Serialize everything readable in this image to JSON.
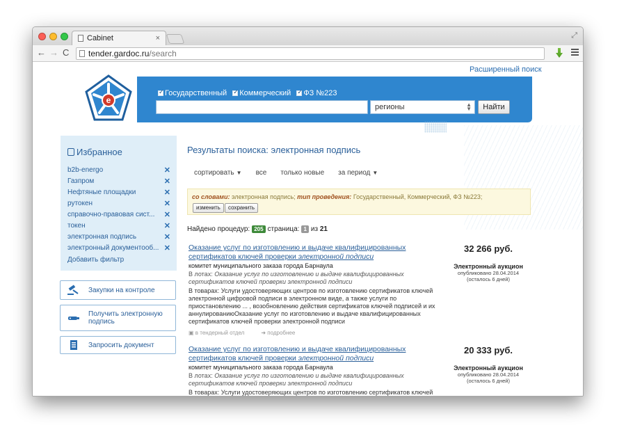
{
  "browser": {
    "tab_title": "Cabinet",
    "tab_close": "×",
    "url_host": "tender.gardoc.ru",
    "url_path": "/search",
    "nav_back": "←",
    "nav_forward": "→",
    "nav_reload": "C"
  },
  "header": {
    "advanced_search": "Расширенный поиск",
    "checkboxes": [
      "Государственный",
      "Коммерческий",
      "ФЗ №223"
    ],
    "search_value": "",
    "regions_value": "регионы",
    "find_button": "Найти",
    "brand_color": "#2f86cf"
  },
  "favorites": {
    "title": "Избранное",
    "items": [
      "b2b-energo",
      "Газпром",
      "Нефтяные площадки",
      "рутокен",
      "справочно-правовая сист...",
      "токен",
      "электронная подпись",
      "электронный документооб..."
    ],
    "remove_glyph": "✕",
    "add_filter": "Добавить фильтр"
  },
  "side_buttons": [
    {
      "label": "Закупки на контроле"
    },
    {
      "label": "Получить электронную подпись"
    },
    {
      "label": "Запросить документ"
    }
  ],
  "results": {
    "heading": "Результаты поиска: электронная подпись",
    "sort": {
      "sort_label": "сортировать",
      "all": "все",
      "new_only": "только новые",
      "period": "за период"
    },
    "filter": {
      "words_label": "со словами:",
      "words_value": "электронная подпись;",
      "type_label": "тип проведения:",
      "type_value": "Государственный, Коммерческий, ФЗ №223;",
      "edit_button": "изменить",
      "save_button": "сохранить"
    },
    "found": {
      "prefix": "Найдено процедур:",
      "count": "205",
      "page_label": "страница:",
      "page": "1",
      "of": "из",
      "total_pages": "21"
    },
    "items": [
      {
        "title_a": "Оказание услуг по изготовлению и выдаче квалифицированных сертификатов ключей проверки ",
        "title_b": "электронной подписи",
        "org": "комитет муниципального заказа города Барнаула",
        "lots_label": "В лотах:",
        "lots_text": "Оказание услуг по изготовлению и выдаче квалифицированных сертификатов ключей проверки электронной подписи",
        "goods_label": "В товарах:",
        "goods_text": "Услуги удостоверяющих центров по изготовлению сертификатов ключей электронной цифровой подписи в электронном виде, а также услуги по приостановлению ... , возобновлению действия сертификатов ключей подписей и их аннулированиюОказание услуг по изготовлению и выдаче квалифицированных сертификатов ключей проверки электронной подписи",
        "to_department": "в тендерный отдел",
        "details": "подробнее",
        "price": "32 266 руб.",
        "auction_type": "Электронный аукцион",
        "published": "опубликовано 28.04.2014",
        "remaining": "(осталось 6 дней)"
      },
      {
        "title_a": "Оказание услуг по изготовлению и выдаче квалифицированных сертификатов ключей проверки ",
        "title_b": "электронной подписи",
        "org": "комитет муниципального заказа города Барнаула",
        "lots_label": "В лотах:",
        "lots_text": "Оказание услуг по изготовлению и выдаче квалифицированных сертификатов ключей проверки электронной подписи",
        "goods_label": "В товарах:",
        "goods_text": "Услуги удостоверяющих центров по изготовлению сертификатов ключей",
        "price": "20 333 руб.",
        "auction_type": "Электронный аукцион",
        "published": "опубликовано 28.04.2014",
        "remaining": "(осталось 6 дней)"
      }
    ]
  }
}
